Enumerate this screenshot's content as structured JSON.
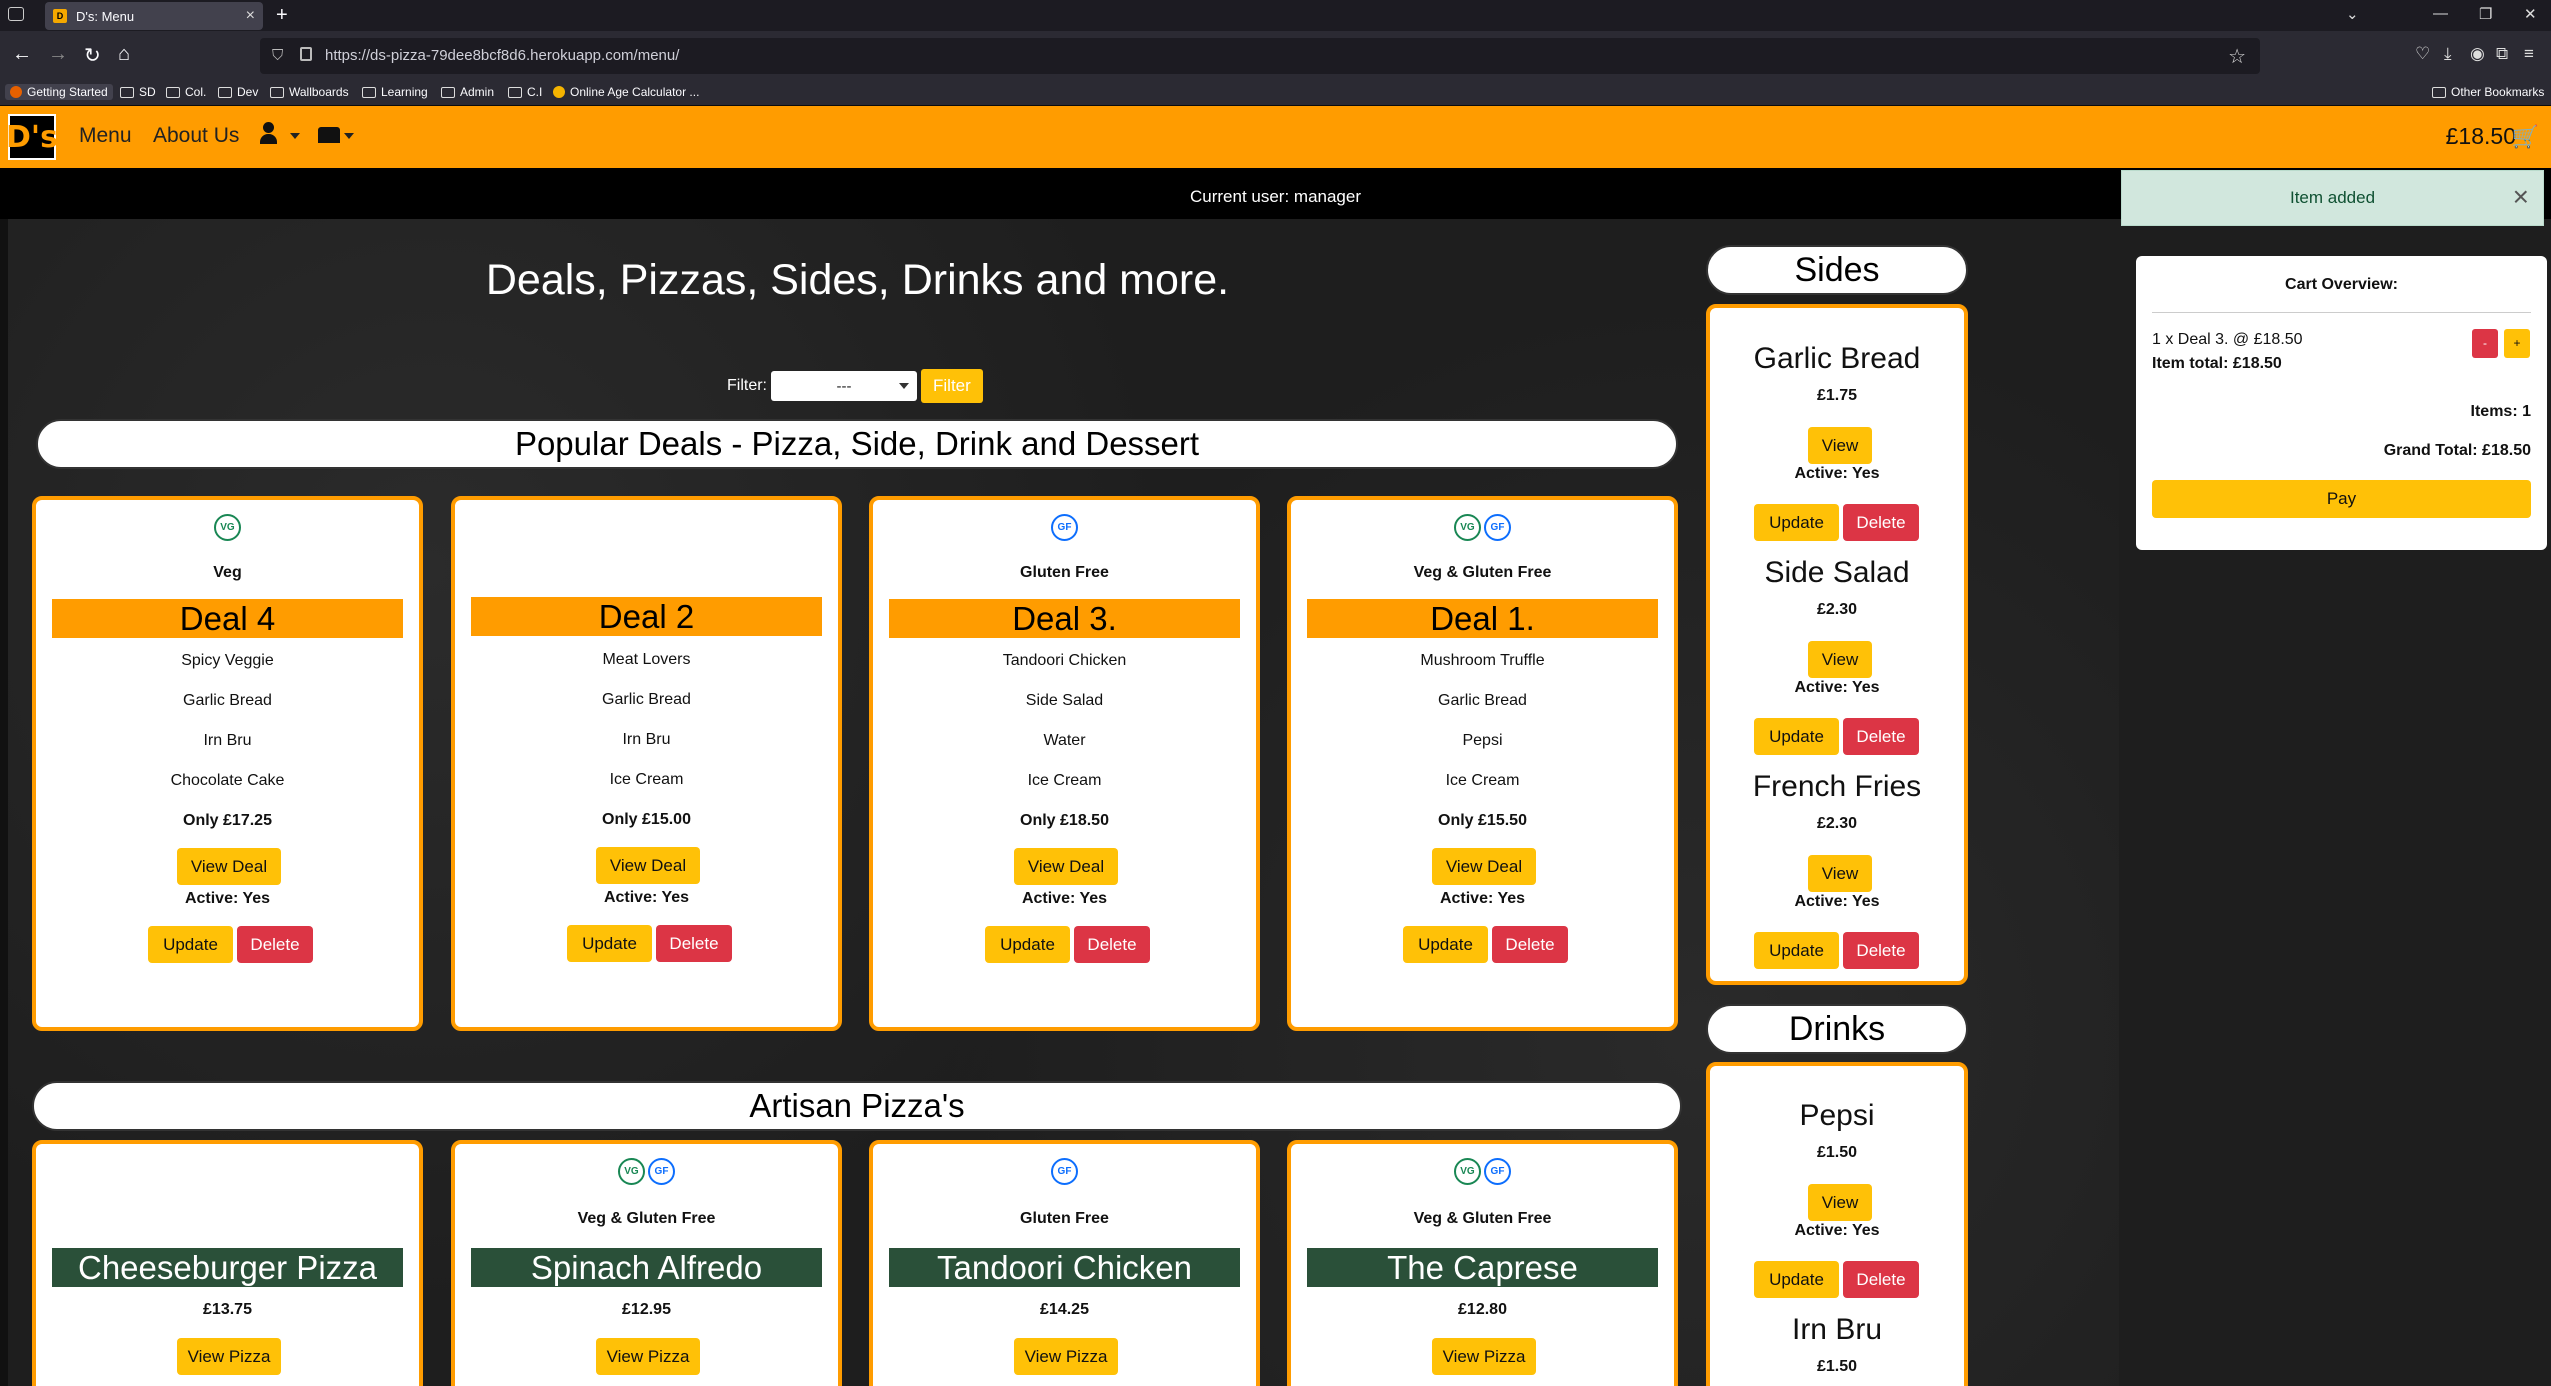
{
  "browser": {
    "tab_title": "D's: Menu",
    "url": "https://ds-pizza-79dee8bcf8d6.herokuapp.com/menu/",
    "bookmarks": [
      "Getting Started",
      "SD",
      "Col.",
      "Dev",
      "Wallboards",
      "Learning",
      "Admin",
      "C.I",
      "Online Age Calculator ..."
    ],
    "other_bookmarks": "Other Bookmarks"
  },
  "site": {
    "logo": "D's",
    "nav": {
      "menu": "Menu",
      "about": "About Us"
    },
    "cart_total": "£18.50",
    "current_user": "Current user: manager"
  },
  "toast": {
    "message": "Item added"
  },
  "cart": {
    "title": "Cart Overview:",
    "line": "1 x Deal 3. @ £18.50",
    "item_total": "Item total: £18.50",
    "minus": "-",
    "plus": "+",
    "items": "Items: 1",
    "grand_total": "Grand Total: £18.50",
    "pay": "Pay"
  },
  "main": {
    "heading": "Deals, Pizzas, Sides, Drinks and more.",
    "filter_label": "Filter:",
    "filter_value": "---",
    "filter_button": "Filter"
  },
  "deals_section": {
    "title": "Popular Deals - Pizza, Side, Drink and Dessert",
    "cards": [
      {
        "badges": [
          "VG"
        ],
        "tag": "Veg",
        "name": "Deal 4",
        "items": [
          "Spicy Veggie",
          "Garlic Bread",
          "Irn Bru",
          "Chocolate Cake"
        ],
        "price": "Only £17.25",
        "view": "View Deal",
        "active": "Active: Yes",
        "update": "Update",
        "delete": "Delete"
      },
      {
        "badges": [],
        "tag": "",
        "name": "Deal 2",
        "items": [
          "Meat Lovers",
          "Garlic Bread",
          "Irn Bru",
          "Ice Cream"
        ],
        "price": "Only £15.00",
        "view": "View Deal",
        "active": "Active: Yes",
        "update": "Update",
        "delete": "Delete"
      },
      {
        "badges": [
          "GF"
        ],
        "tag": "Gluten Free",
        "name": "Deal 3.",
        "items": [
          "Tandoori Chicken",
          "Side Salad",
          "Water",
          "Ice Cream"
        ],
        "price": "Only £18.50",
        "view": "View Deal",
        "active": "Active: Yes",
        "update": "Update",
        "delete": "Delete"
      },
      {
        "badges": [
          "VG",
          "GF"
        ],
        "tag": "Veg & Gluten Free",
        "name": "Deal 1.",
        "items": [
          "Mushroom Truffle",
          "Garlic Bread",
          "Pepsi",
          "Ice Cream"
        ],
        "price": "Only £15.50",
        "view": "View Deal",
        "active": "Active: Yes",
        "update": "Update",
        "delete": "Delete"
      }
    ]
  },
  "pizza_section": {
    "title": "Artisan Pizza's",
    "cards": [
      {
        "badges": [],
        "tag": "",
        "name": "Cheeseburger Pizza",
        "price": "£13.75",
        "view": "View Pizza"
      },
      {
        "badges": [
          "VG",
          "GF"
        ],
        "tag": "Veg & Gluten Free",
        "name": "Spinach Alfredo",
        "price": "£12.95",
        "view": "View Pizza"
      },
      {
        "badges": [
          "GF"
        ],
        "tag": "Gluten Free",
        "name": "Tandoori Chicken",
        "price": "£14.25",
        "view": "View Pizza"
      },
      {
        "badges": [
          "VG",
          "GF"
        ],
        "tag": "Veg & Gluten Free",
        "name": "The Caprese",
        "price": "£12.80",
        "view": "View Pizza"
      }
    ]
  },
  "sides": {
    "title": "Sides",
    "items": [
      {
        "name": "Garlic Bread",
        "price": "£1.75",
        "view": "View",
        "active": "Active: Yes",
        "update": "Update",
        "delete": "Delete"
      },
      {
        "name": "Side Salad",
        "price": "£2.30",
        "view": "View",
        "active": "Active: Yes",
        "update": "Update",
        "delete": "Delete"
      },
      {
        "name": "French Fries",
        "price": "£2.30",
        "view": "View",
        "active": "Active: Yes",
        "update": "Update",
        "delete": "Delete"
      }
    ]
  },
  "drinks": {
    "title": "Drinks",
    "items": [
      {
        "name": "Pepsi",
        "price": "£1.50",
        "view": "View",
        "active": "Active: Yes",
        "update": "Update",
        "delete": "Delete"
      },
      {
        "name": "Irn Bru",
        "price": "£1.50"
      }
    ]
  },
  "colors": {
    "brand_orange": "#ff9c00",
    "button_yellow": "#ffc107",
    "delete_red": "#dc3545",
    "pizza_green": "#2a5039"
  }
}
